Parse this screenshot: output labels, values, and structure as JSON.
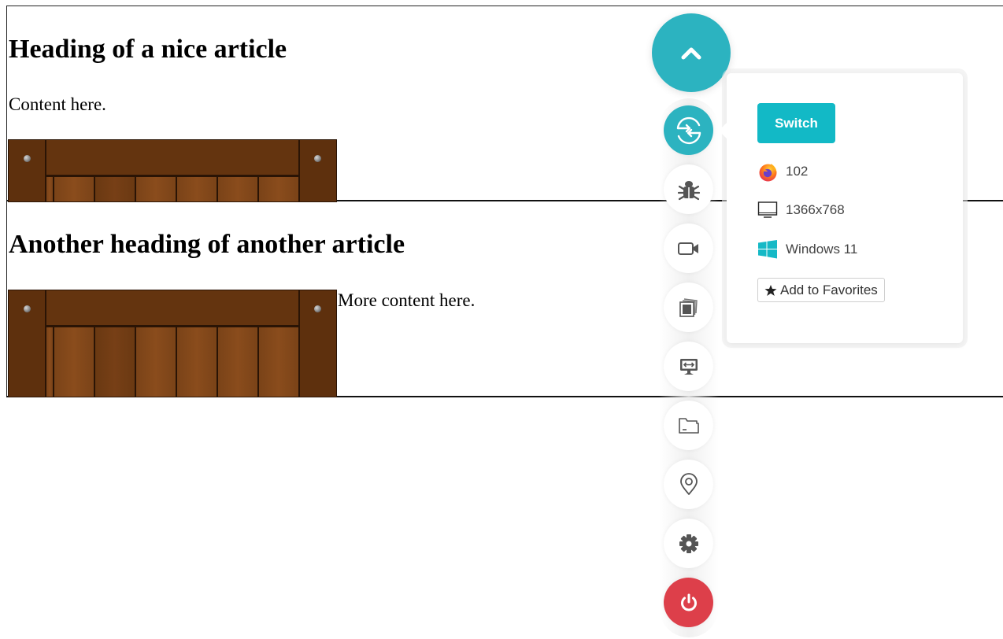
{
  "articles": [
    {
      "heading": "Heading of a nice article",
      "content": "Content here.",
      "image": "wooden-crate"
    },
    {
      "heading": "Another heading of another article",
      "content": "More content here.",
      "image": "wooden-crate"
    }
  ],
  "toolbar": {
    "accent_color": "#2cb3c0",
    "danger_color": "#dd3f4a",
    "collapse_icon": "chevron-up-icon",
    "tools": [
      {
        "name": "switch",
        "icon": "switch-browser-icon",
        "active": true
      },
      {
        "name": "debug",
        "icon": "bug-icon"
      },
      {
        "name": "record-video",
        "icon": "video-camera-icon"
      },
      {
        "name": "screenshots",
        "icon": "gallery-icon"
      },
      {
        "name": "resolution",
        "icon": "monitor-resize-icon"
      },
      {
        "name": "files",
        "icon": "folder-icon"
      },
      {
        "name": "geolocation",
        "icon": "map-pin-icon"
      },
      {
        "name": "settings",
        "icon": "gear-icon"
      },
      {
        "name": "end-session",
        "icon": "power-icon"
      }
    ]
  },
  "panel": {
    "switch_label": "Switch",
    "browser_version": "102",
    "browser_icon": "firefox-icon",
    "resolution": "1366x768",
    "resolution_icon": "monitor-icon",
    "os": "Windows 11",
    "os_icon": "windows-icon",
    "favorite_label": "Add to Favorites",
    "favorite_icon": "star-icon"
  }
}
